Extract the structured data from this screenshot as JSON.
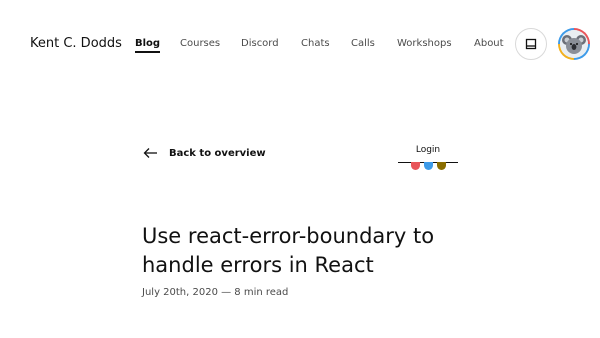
{
  "header": {
    "brand": "Kent C. Dodds",
    "nav": [
      "Blog",
      "Courses",
      "Discord",
      "Chats",
      "Calls",
      "Workshops",
      "About"
    ],
    "active": "Blog",
    "theme_icon": "sidebar-layout-icon",
    "avatar_icon": "koala-avatar"
  },
  "back_link": {
    "label": "Back to overview",
    "icon": "arrow-left-icon"
  },
  "login": {
    "label": "Login",
    "dot_colors": [
      "#e8555a",
      "#3d9be9",
      "#8a6d00"
    ]
  },
  "article": {
    "title": "Use react-error-boundary to handle errors in React",
    "meta": "July 20th, 2020 — 8 min read"
  },
  "colors": {
    "text": "#111111",
    "muted": "#4b4b4b",
    "accent_red": "#e8555a",
    "accent_blue": "#3d9be9",
    "accent_yellow": "#f2b01e"
  }
}
